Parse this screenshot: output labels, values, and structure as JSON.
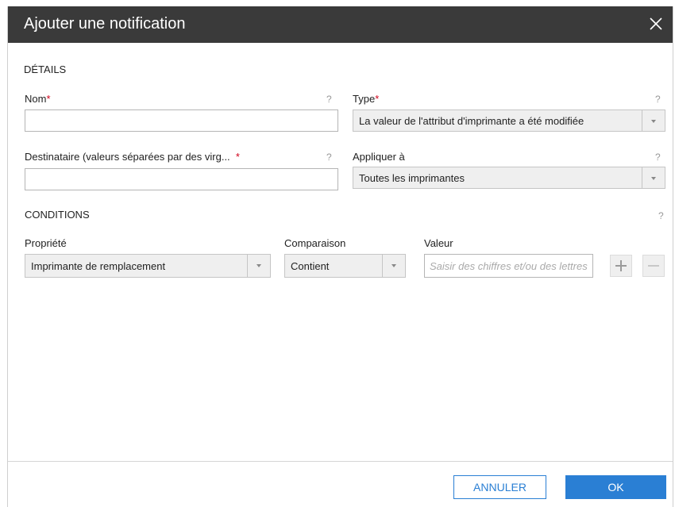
{
  "dialog": {
    "title": "Ajouter une notification"
  },
  "details": {
    "section_title": "DÉTAILS",
    "name": {
      "label": "Nom",
      "value": "",
      "help": "?"
    },
    "type": {
      "label": "Type",
      "value": "La valeur de l'attribut d'imprimante a été modifiée",
      "help": "?"
    },
    "recipient": {
      "label": "Destinataire (valeurs séparées par des virg...",
      "value": "",
      "help": "?"
    },
    "apply_to": {
      "label": "Appliquer à",
      "value": "Toutes les imprimantes",
      "help": "?"
    },
    "required_mark": "*"
  },
  "conditions": {
    "section_title": "CONDITIONS",
    "help": "?",
    "property": {
      "label": "Propriété",
      "value": "Imprimante de remplacement"
    },
    "comparison": {
      "label": "Comparaison",
      "value": "Contient"
    },
    "value": {
      "label": "Valeur",
      "placeholder": "Saisir des chiffres et/ou des lettres"
    }
  },
  "footer": {
    "cancel_label": "ANNULER",
    "ok_label": "OK"
  },
  "colors": {
    "titlebar": "#3a3a3a",
    "accent": "#2a7fd4",
    "required": "#d0021b"
  },
  "icons": [
    "close-icon",
    "help-icon",
    "chevron-down-icon",
    "plus-icon",
    "minus-icon"
  ]
}
